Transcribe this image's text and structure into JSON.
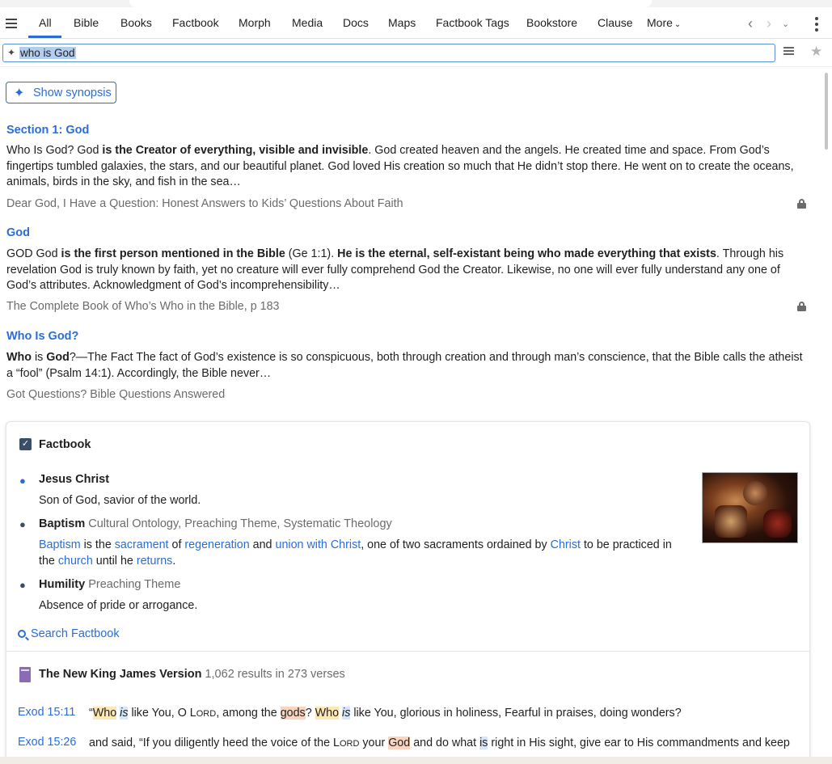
{
  "tabs": [
    {
      "label": "All",
      "active": true
    },
    {
      "label": "Bible"
    },
    {
      "label": "Books"
    },
    {
      "label": "Factbook"
    },
    {
      "label": "Morph"
    },
    {
      "label": "Media"
    },
    {
      "label": "Docs"
    },
    {
      "label": "Maps"
    },
    {
      "label": "Factbook Tags"
    },
    {
      "label": "Bookstore"
    },
    {
      "label": "Clause"
    },
    {
      "label": "More"
    }
  ],
  "search": {
    "query": "who is God"
  },
  "synopsis_button": "Show synopsis",
  "results": [
    {
      "title": "Section 1: God",
      "body": [
        {
          "t": "Who Is God? God "
        },
        {
          "t": "is the Creator of everything, visible and invisible",
          "b": true
        },
        {
          "t": ". God created heaven and the angels. He created time and space. From God’s fingertips tumbled galaxies, the stars, and our beautiful planet. God loved His creation so much that He didn’t stop there. He went on to create the oceans, animals, birds in the sky, and fish in the sea…"
        }
      ],
      "source": "Dear God, I Have a Question: Honest Answers to Kids’ Questions About Faith",
      "locked": true
    },
    {
      "title": "God",
      "body": [
        {
          "t": "GOD God "
        },
        {
          "t": "is the first person mentioned in the Bible",
          "b": true
        },
        {
          "t": " (Ge 1:1). "
        },
        {
          "t": "He is the eternal, self-existant being who made everything that exists",
          "b": true
        },
        {
          "t": ". Through his revelation God is truly known by faith, yet no creature will ever fully comprehend God the Creator. Likewise, no one will ever fully understand any one of God’s attributes. Acknowledgment of God’s incomprehensibility…"
        }
      ],
      "source": "The Complete Book of Who’s Who in the Bible, p 183",
      "locked": true
    },
    {
      "title": "Who Is God?",
      "body": [
        {
          "t": "Who",
          "b": true
        },
        {
          "t": " is "
        },
        {
          "t": "God",
          "b": true
        },
        {
          "t": "?—The Fact The fact of God’s existence is so conspicuous, both through creation and through man’s conscience, that the Bible calls the atheist a “fool” (Psalm 14:1). Accordingly, the Bible never…"
        }
      ],
      "source": "Got Questions? Bible Questions Answered",
      "locked": false
    }
  ],
  "factbook": {
    "title": "Factbook",
    "entries": [
      {
        "name": "Jesus Christ",
        "tags": "",
        "icon": "person-icon",
        "desc": [
          {
            "t": "Son of God, savior of the world."
          }
        ]
      },
      {
        "name": "Baptism",
        "tags": "Cultural Ontology, Preaching Theme, Systematic Theology",
        "icon": "speech-bubble-icon",
        "desc": [
          {
            "t": "Baptism",
            "l": true
          },
          {
            "t": " is the "
          },
          {
            "t": "sacrament",
            "l": true
          },
          {
            "t": " of "
          },
          {
            "t": "regeneration",
            "l": true
          },
          {
            "t": " and "
          },
          {
            "t": "union with Christ",
            "l": true
          },
          {
            "t": ", one of two sacraments ordained by "
          },
          {
            "t": "Christ",
            "l": true
          },
          {
            "t": " to be practiced in the "
          },
          {
            "t": "church",
            "l": true
          },
          {
            "t": " until he "
          },
          {
            "t": "returns",
            "l": true
          },
          {
            "t": "."
          }
        ]
      },
      {
        "name": "Humility",
        "tags": "Preaching Theme",
        "icon": "speech-bubble-icon",
        "desc": [
          {
            "t": "Absence of pride or arrogance."
          }
        ]
      }
    ],
    "search_link": "Search Factbook"
  },
  "bible": {
    "title": "The New King James Version",
    "count": "1,062 results in 273 verses",
    "verses": [
      {
        "ref": "Exod 15:11",
        "parts": [
          {
            "t": "“"
          },
          {
            "t": "Who",
            "h": "y"
          },
          {
            "t": " "
          },
          {
            "t": "is",
            "h": "b",
            "i": true
          },
          {
            "t": " like You, O L"
          },
          {
            "t": "ORD",
            "sc": true
          },
          {
            "t": ", among the "
          },
          {
            "t": "gods",
            "h": "o"
          },
          {
            "t": "? "
          },
          {
            "t": "Who",
            "h": "y"
          },
          {
            "t": " "
          },
          {
            "t": "is",
            "h": "b",
            "i": true
          },
          {
            "t": " like You, glorious in holiness, Fearful in praises, doing wonders?"
          }
        ]
      },
      {
        "ref": "Exod 15:26",
        "parts": [
          {
            "t": "and said, “If you diligently heed the voice of the L"
          },
          {
            "t": "ORD",
            "sc": true
          },
          {
            "t": " your "
          },
          {
            "t": "God",
            "h": "o"
          },
          {
            "t": " and do what "
          },
          {
            "t": "is",
            "h": "b"
          },
          {
            "t": " right in His sight, give ear to His commandments and keep"
          }
        ]
      }
    ]
  }
}
